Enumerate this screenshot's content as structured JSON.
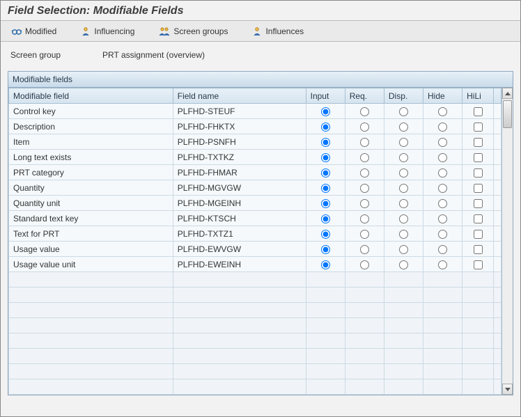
{
  "title": "Field Selection: Modifiable Fields",
  "toolbar": {
    "modified": "Modified",
    "influencing": "Influencing",
    "screen_groups": "Screen groups",
    "influences": "Influences"
  },
  "screen_group": {
    "label": "Screen group",
    "value": "PRT assignment (overview)"
  },
  "table": {
    "title": "Modifiable fields",
    "columns": {
      "modifiable_field": "Modifiable field",
      "field_name": "Field name",
      "input": "Input",
      "req": "Req.",
      "disp": "Disp.",
      "hide": "Hide",
      "hili": "HiLi"
    },
    "rows": [
      {
        "label": "Control key",
        "name": "PLFHD-STEUF",
        "sel": "input",
        "hili": false
      },
      {
        "label": "Description",
        "name": "PLFHD-FHKTX",
        "sel": "input",
        "hili": false
      },
      {
        "label": "Item",
        "name": "PLFHD-PSNFH",
        "sel": "input",
        "hili": false
      },
      {
        "label": "Long text exists",
        "name": "PLFHD-TXTKZ",
        "sel": "input",
        "hili": false
      },
      {
        "label": "PRT category",
        "name": "PLFHD-FHMAR",
        "sel": "input",
        "hili": false
      },
      {
        "label": "Quantity",
        "name": "PLFHD-MGVGW",
        "sel": "input",
        "hili": false
      },
      {
        "label": "Quantity unit",
        "name": "PLFHD-MGEINH",
        "sel": "input",
        "hili": false
      },
      {
        "label": "Standard text key",
        "name": "PLFHD-KTSCH",
        "sel": "input",
        "hili": false
      },
      {
        "label": "Text for PRT",
        "name": "PLFHD-TXTZ1",
        "sel": "input",
        "hili": false
      },
      {
        "label": "Usage value",
        "name": "PLFHD-EWVGW",
        "sel": "input",
        "hili": false
      },
      {
        "label": "Usage value unit",
        "name": "PLFHD-EWEINH",
        "sel": "input",
        "hili": false
      }
    ],
    "empty_row_count": 8
  }
}
